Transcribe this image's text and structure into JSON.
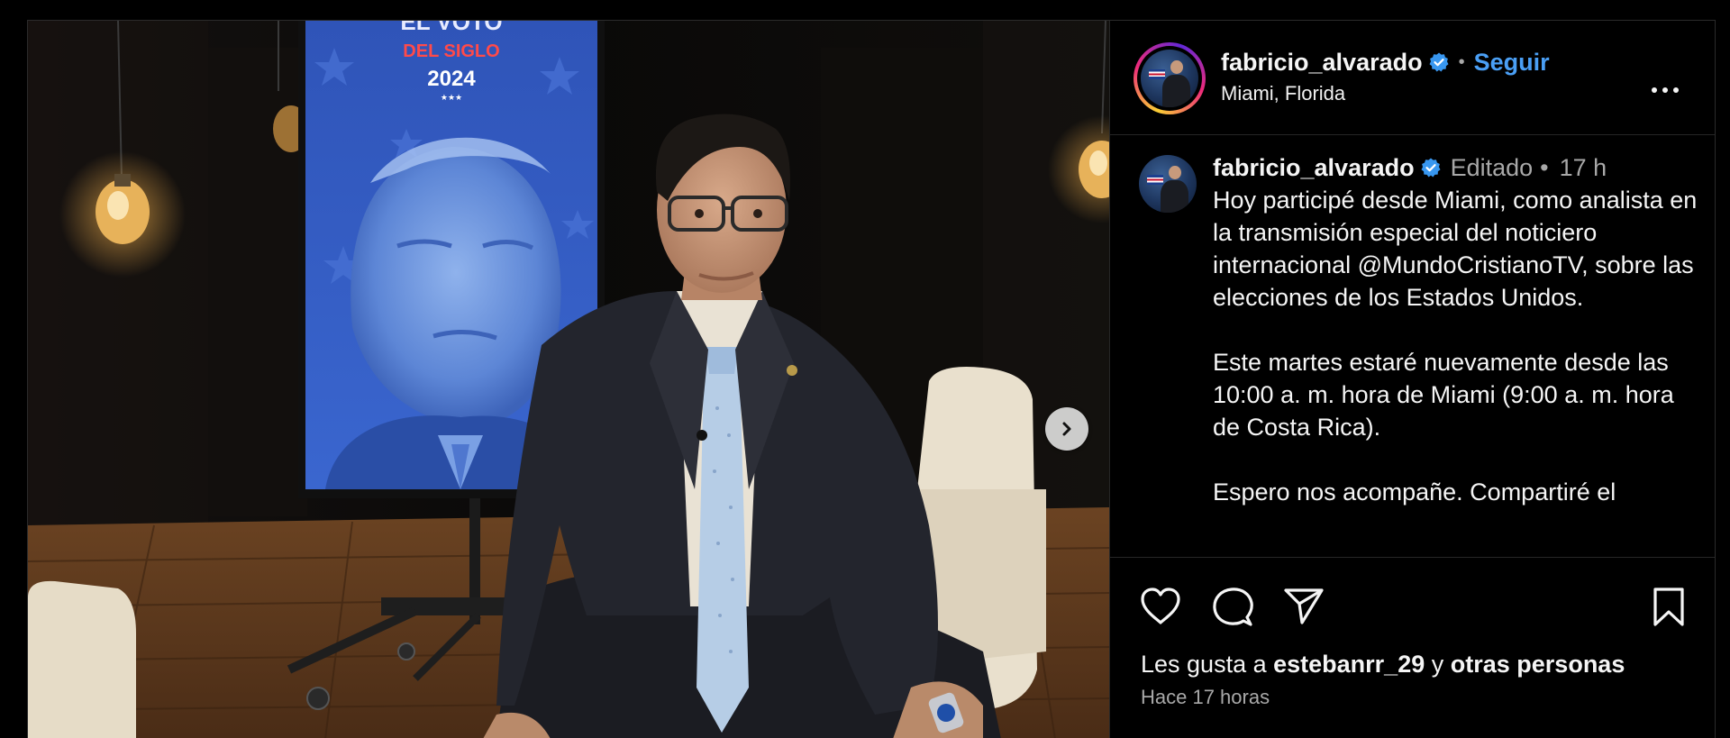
{
  "post": {
    "poster_text": {
      "line1": "EL VOTO",
      "line2": "DEL SIGLO",
      "line3": "2024",
      "stars": "★★★"
    }
  },
  "header": {
    "username": "fabricio_alvarado",
    "separator": "•",
    "follow_label": "Seguir",
    "location": "Miami, Florida"
  },
  "caption": {
    "username": "fabricio_alvarado",
    "edited_label": "Editado",
    "separator": "•",
    "timestamp": "17 h",
    "text": "Hoy participé desde Miami, como analista en la transmisión especial del noticiero internacional @MundoCristianoTV, sobre las elecciones de los Estados Unidos.\n\nEste martes estaré nuevamente desde las 10:00 a. m. hora de Miami (9:00 a. m. hora de Costa Rica).\n\nEspero nos acompañe. Compartiré el"
  },
  "footer": {
    "likes_prefix": "Les gusta a",
    "likes_user": "estebanrr_29",
    "likes_join": "y",
    "likes_others": "otras personas",
    "time_ago": "Hace 17 horas"
  },
  "icons": {
    "verified": "verified-badge-icon",
    "more": "more-options-icon",
    "next": "chevron-right-icon",
    "like": "heart-icon",
    "comment": "comment-bubble-icon",
    "share": "paper-plane-icon",
    "save": "bookmark-icon"
  },
  "colors": {
    "follow_blue": "#4a9ff5",
    "verified_blue": "#3897f0",
    "muted": "#a8a8a8",
    "background": "#000000"
  }
}
